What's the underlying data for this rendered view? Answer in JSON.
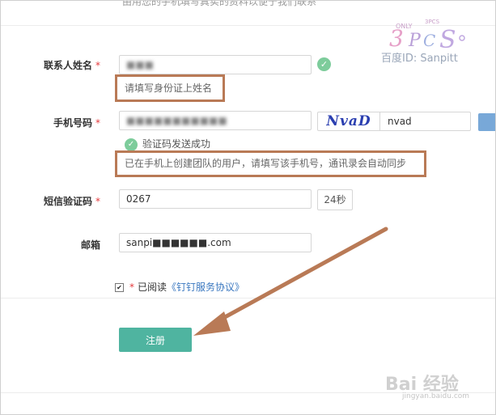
{
  "form": {
    "top_cut_text": "由用您的手机填写真实的资料以便于我们联系",
    "name": {
      "label": "联系人姓名",
      "required": "*",
      "value": "■■■",
      "hint": "请填写身份证上姓名"
    },
    "phone": {
      "label": "手机号码",
      "required": "*",
      "value": "■■■■■■■■■■■",
      "captcha_image_text": "NvaD",
      "captcha_value": "nvad",
      "success": "验证码发送成功",
      "hint": "已在手机上创建团队的用户，请填写该手机号，通讯录会自动同步"
    },
    "sms": {
      "label": "短信验证码",
      "required": "*",
      "value": "0267",
      "countdown": "24秒"
    },
    "email": {
      "label": "邮箱",
      "value": "sanpi■■■■■■.com"
    },
    "agreement": {
      "checkbox": "✔",
      "required": "*",
      "prefix": "已阅读",
      "link": "《钉钉服务协议》"
    },
    "submit_label": "注册"
  },
  "watermark": {
    "baidu_id": "百度ID: Sanpitt",
    "baidu_logo": "Bai 经验",
    "baidu_url": "jingyan.baidu.com"
  },
  "colors": {
    "accent": "#4fb4a0",
    "highlight": "#b97a56",
    "link": "#3b78c0",
    "success": "#7dcc9b",
    "required": "#e4393c"
  }
}
